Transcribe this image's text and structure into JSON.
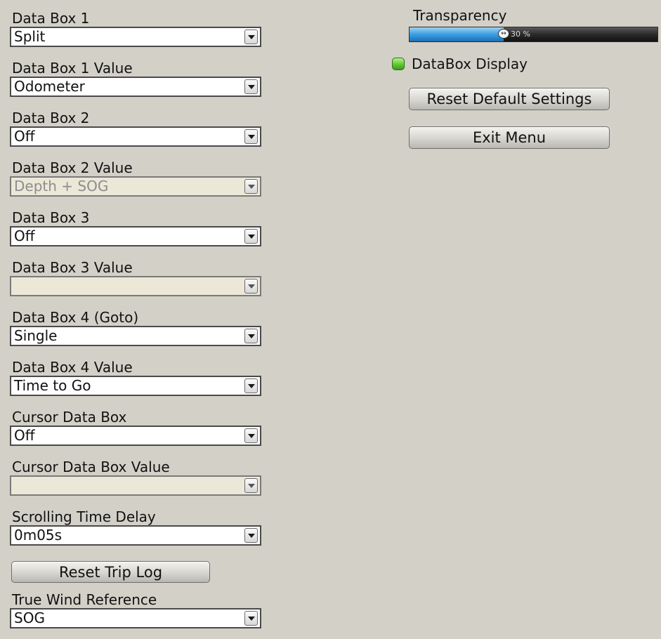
{
  "fields": [
    {
      "label": "Data Box 1",
      "value": "Split",
      "disabled": false
    },
    {
      "label": "Data Box 1 Value",
      "value": "Odometer",
      "disabled": false
    },
    {
      "label": "Data Box 2",
      "value": "Off",
      "disabled": false
    },
    {
      "label": "Data Box 2 Value",
      "value": "Depth + SOG",
      "disabled": true
    },
    {
      "label": "Data Box 3",
      "value": "Off",
      "disabled": false
    },
    {
      "label": "Data Box 3 Value",
      "value": "",
      "disabled": true
    },
    {
      "label": "Data Box 4 (Goto)",
      "value": "Single",
      "disabled": false
    },
    {
      "label": "Data Box 4 Value",
      "value": "Time to Go",
      "disabled": false
    },
    {
      "label": "Cursor Data Box",
      "value": "Off",
      "disabled": false
    },
    {
      "label": "Cursor Data Box Value",
      "value": "",
      "disabled": true
    },
    {
      "label": "Scrolling Time Delay",
      "value": "0m05s",
      "disabled": false
    }
  ],
  "reset_trip_log": {
    "label": "Reset Trip Log"
  },
  "true_wind": {
    "label": "True Wind Reference",
    "value": "SOG"
  },
  "transparency": {
    "label": "Transparency",
    "value_text": "30 %",
    "fraction": 0.38,
    "thumb_glyph": "↔"
  },
  "databox_display": {
    "label": "DataBox Display",
    "checked": true
  },
  "reset_default": {
    "label": "Reset Default Settings"
  },
  "exit_menu": {
    "label": "Exit Menu"
  },
  "colors": {
    "background": "#d3d0c8",
    "slider_fill": "#3a9ee2",
    "checkbox_on": "#5cc42e",
    "disabled_field": "#ece8d8"
  },
  "icons": {
    "select_arrow": "chevron-down-icon",
    "slider_thumb": "drag-handle-icon"
  }
}
